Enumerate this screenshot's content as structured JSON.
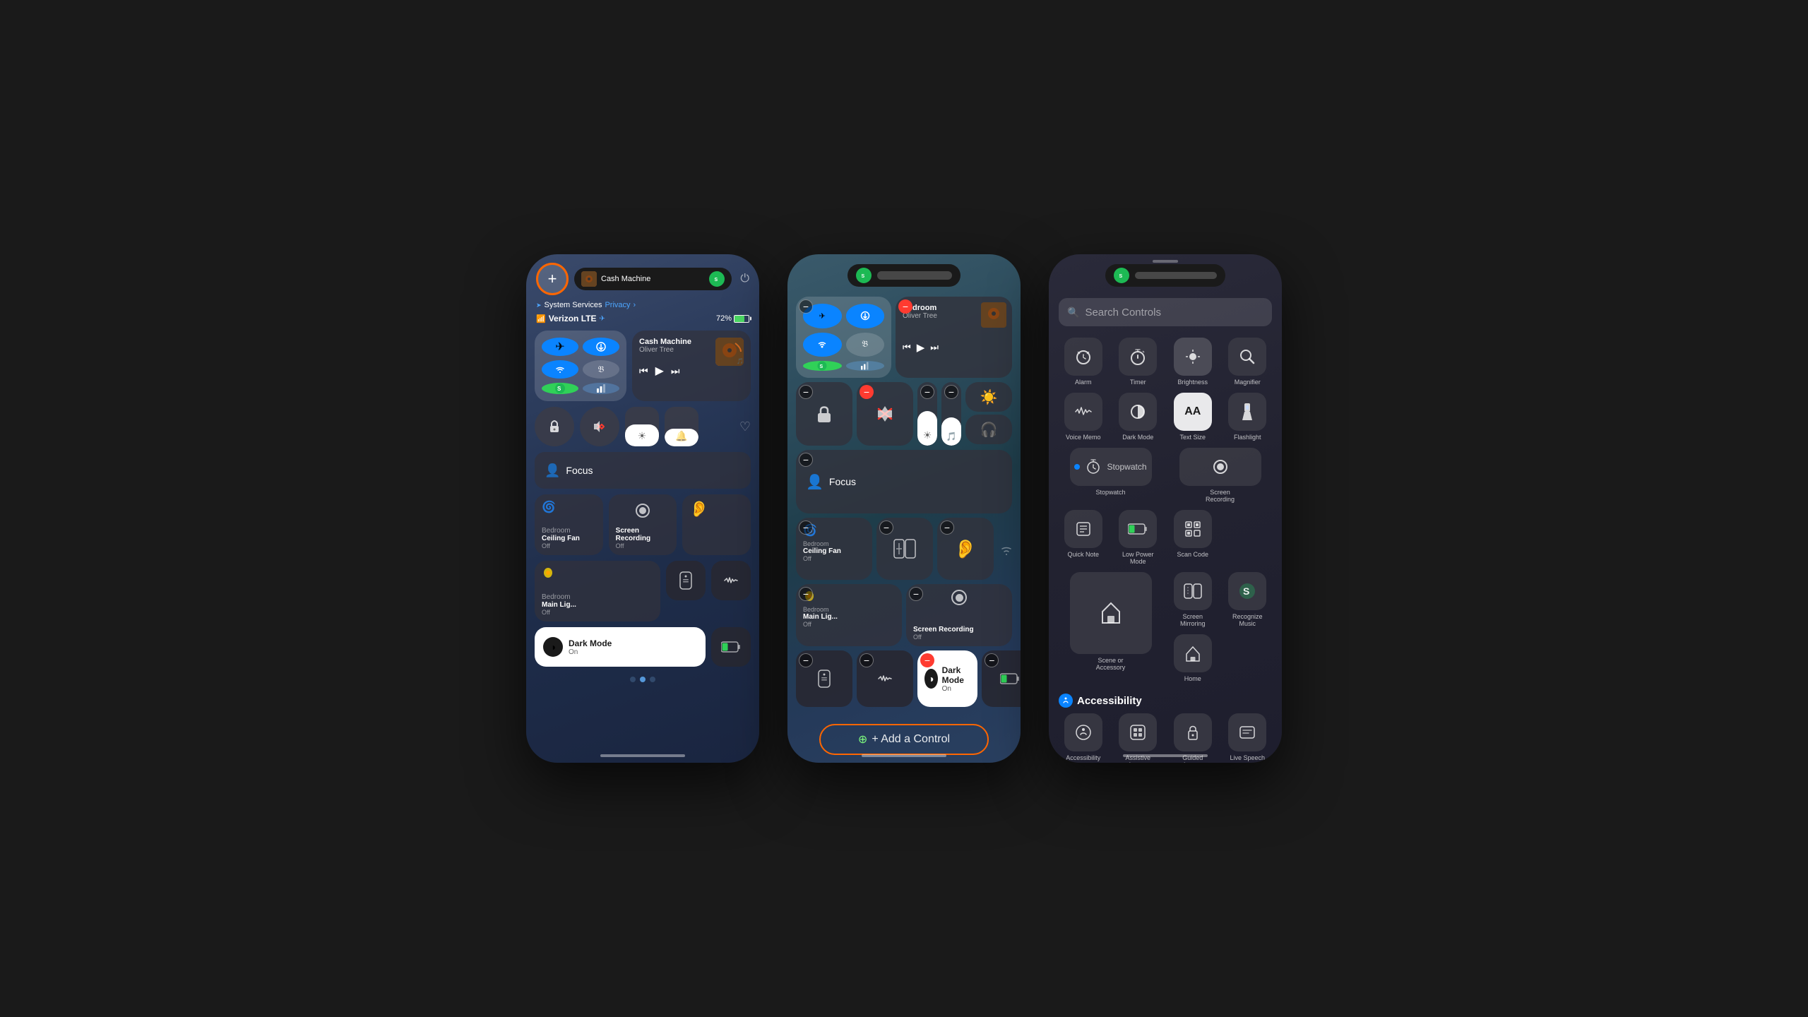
{
  "phone1": {
    "topbar": {
      "plus_label": "+",
      "carrier": "Verizon LTE",
      "battery_pct": "72%",
      "music_title": "Cash Machine",
      "music_artist": "Oliver Tree"
    },
    "system_services": {
      "label": "System Services",
      "privacy": "Privacy",
      "arrow": "›"
    },
    "controls": {
      "focus_label": "Focus",
      "ceiling_fan_name": "Bedroom",
      "ceiling_fan_label": "Ceiling Fan",
      "ceiling_fan_sub": "Off",
      "main_light_name": "Bedroom",
      "main_light_label": "Main Lig...",
      "main_light_sub": "Off",
      "screen_rec_label": "Screen\nRecording",
      "screen_rec_sub": "Off",
      "dark_mode_label": "Dark Mode",
      "dark_mode_sub": "On"
    }
  },
  "phone2": {
    "topbar": {
      "pill_label": ""
    },
    "controls": {
      "focus_label": "Focus",
      "ceiling_fan_name": "Bedroom",
      "ceiling_fan_label": "Ceiling Fan",
      "ceiling_fan_sub": "Off",
      "main_light_name": "Bedroom",
      "main_light_label": "Bedroom\nMain Lig...",
      "main_light_sub": "Off",
      "screen_rec_label": "Screen\nRecording",
      "screen_rec_sub": "Off",
      "dark_mode_label": "Dark Mode",
      "dark_mode_sub": "On"
    },
    "add_control_btn": "+ Add a Control"
  },
  "phone3": {
    "search_placeholder": "Search Controls",
    "controls": [
      {
        "id": "alarm",
        "label": "Alarm",
        "icon": "⏰"
      },
      {
        "id": "timer",
        "label": "Timer",
        "icon": "⏱"
      },
      {
        "id": "brightness",
        "label": "Brightness",
        "icon": "☀"
      },
      {
        "id": "magnifier",
        "label": "Magnifier",
        "icon": "🔍"
      },
      {
        "id": "voice-memo",
        "label": "Voice Memo",
        "icon": "🎤"
      },
      {
        "id": "dark-mode",
        "label": "Dark Mode",
        "icon": "◑"
      },
      {
        "id": "text-size",
        "label": "Text Size",
        "icon": "AA"
      },
      {
        "id": "flashlight",
        "label": "Flashlight",
        "icon": "🔦"
      },
      {
        "id": "stopwatch",
        "label": "Stopwatch",
        "icon": "⏱",
        "wide": true
      },
      {
        "id": "quick-note",
        "label": "Quick Note",
        "icon": "📋"
      },
      {
        "id": "low-power",
        "label": "Low Power\nMode",
        "icon": "🔋"
      },
      {
        "id": "scan-code",
        "label": "Scan Code",
        "icon": "⊞"
      },
      {
        "id": "scene",
        "label": "Scene or\nAccessory",
        "icon": "🏠",
        "tall": true
      },
      {
        "id": "screen-mirror",
        "label": "Screen\nMirroring",
        "icon": "▣"
      },
      {
        "id": "recognize-music",
        "label": "Recognize\nMusic",
        "icon": "S"
      },
      {
        "id": "home",
        "label": "Home",
        "icon": "⌂"
      }
    ],
    "accessibility": {
      "section_label": "Accessibility",
      "items": [
        {
          "id": "accessibility-shortcuts",
          "label": "Accessibility\nShortcuts",
          "icon": "♿"
        },
        {
          "id": "assistive-access",
          "label": "Assistive\nAccess",
          "icon": "⊡"
        },
        {
          "id": "guided-access",
          "label": "Guided\nAccess",
          "icon": "🔒"
        },
        {
          "id": "live-speech",
          "label": "Live Speech",
          "icon": "⌨"
        }
      ]
    }
  }
}
